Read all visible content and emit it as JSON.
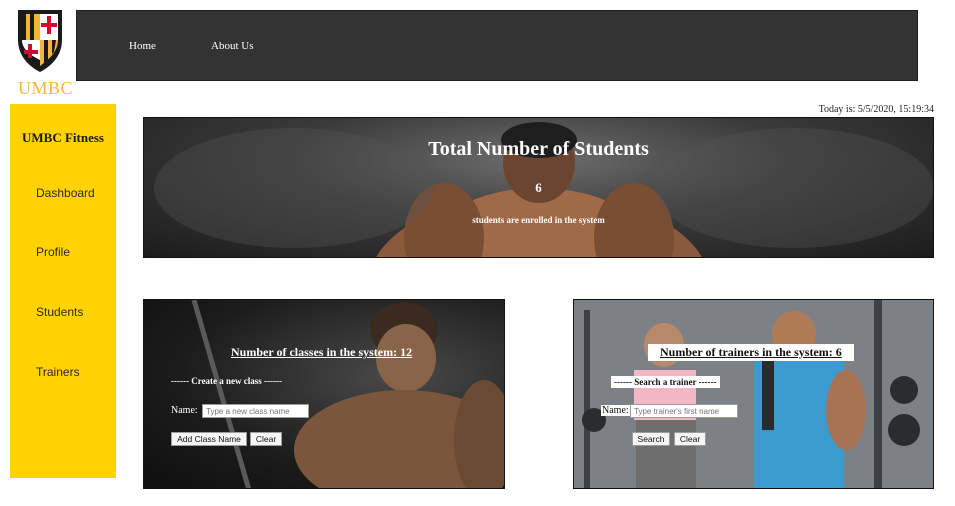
{
  "logo": {
    "text": "UMBC"
  },
  "topnav": {
    "items": [
      "Home",
      "About Us"
    ]
  },
  "sidebar": {
    "brand": "UMBC Fitness",
    "items": [
      {
        "label": "Dashboard"
      },
      {
        "label": "Profile"
      },
      {
        "label": "Students"
      },
      {
        "label": "Trainers"
      }
    ]
  },
  "datetime": "Today is: 5/5/2020, 15:19:34",
  "hero": {
    "title": "Total Number of Students",
    "count": "6",
    "subtitle": "students are enrolled in the system"
  },
  "classes_panel": {
    "heading": "Number of classes in the system: 12",
    "legend": "------ Create a new class ------",
    "name_label": "Name:",
    "input_placeholder": "Type a new class name",
    "add_button": "Add Class Name",
    "clear_button": "Clear"
  },
  "trainers_panel": {
    "heading": "Number of trainers in the system: 6",
    "legend": "------ Search a trainer ------",
    "name_label": "Name:",
    "input_placeholder": "Type trainer's first name",
    "search_button": "Search",
    "clear_button": "Clear"
  },
  "colors": {
    "sidebar": "#ffd200",
    "nav": "#333333",
    "logo_gold": "#f3b63a",
    "shield_red": "#c8102e"
  }
}
